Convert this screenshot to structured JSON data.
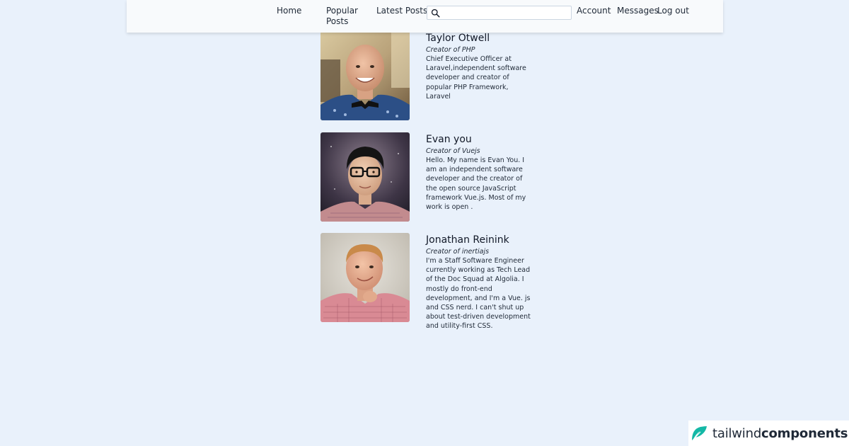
{
  "nav": {
    "home": "Home",
    "popular": "Popular Posts",
    "latest": "Latest Posts",
    "search_placeholder": "",
    "search_value": "",
    "account": "Account",
    "messages": "Messages",
    "logout": "Log out"
  },
  "profiles": [
    {
      "name": "Taylor Otwell",
      "role": "Creator of PHP",
      "bio": "Chief Executive Officer at Laravel,independent software developer and creator of popular PHP Framework, Laravel"
    },
    {
      "name": "Evan you",
      "role": "Creator of Vuejs",
      "bio": "Hello. My name is Evan You. I am an independent software developer and the creator of the open source JavaScript framework Vue.js. Most of my work is open ."
    },
    {
      "name": "Jonathan Reinink",
      "role": "Creator of inertiajs",
      "bio": "I'm a Staff Software Engineer currently working as Tech Lead of the Doc Squad at Algolia. I mostly do front-end development, and I'm a Vue. js and CSS nerd. I can't shut up about test-driven development and utility-first CSS."
    }
  ],
  "brand": {
    "light": "tailwind",
    "bold": "components"
  },
  "colors": {
    "page_background": "#e9f1fb",
    "navbar_background": "#f8fafc",
    "brand_accent": "#14b8a6"
  }
}
